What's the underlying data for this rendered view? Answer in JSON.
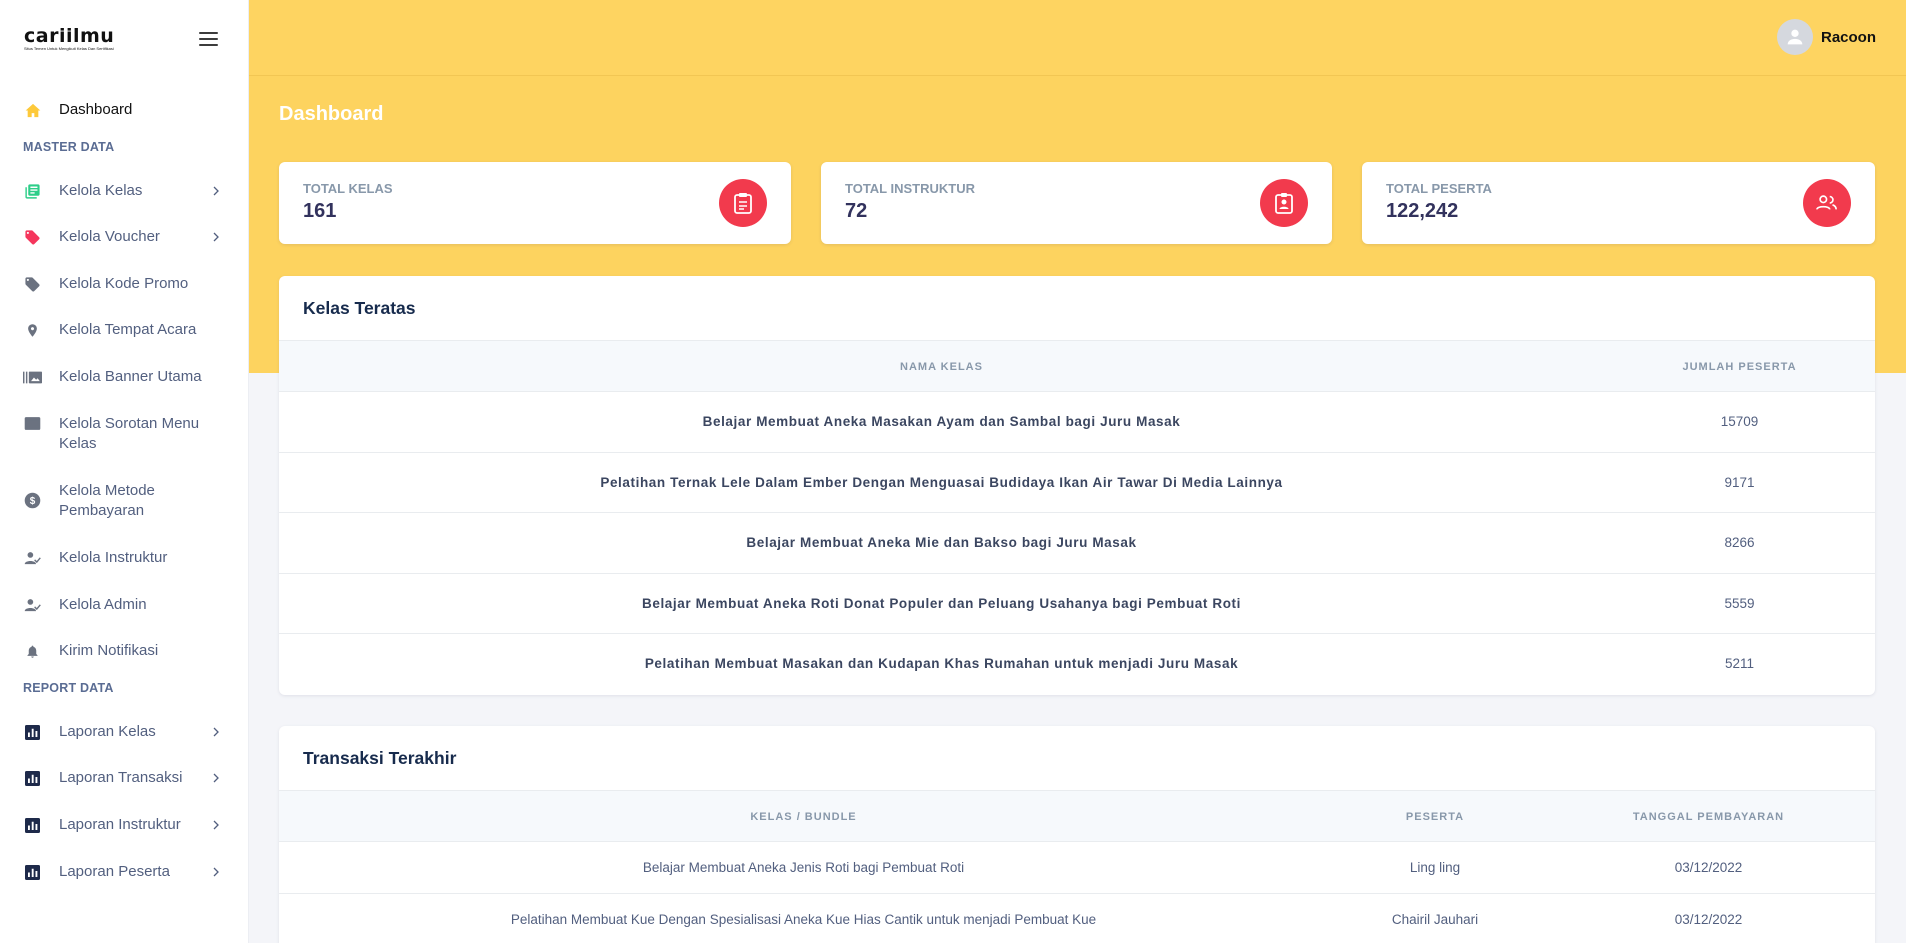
{
  "brand": {
    "name": "cariilmu",
    "tagline": "Situs Temen Untuk Mengikuti Kelas Dan Sertifikasi"
  },
  "sidebar": {
    "dashboard": "Dashboard",
    "master_title": "MASTER DATA",
    "master_items": [
      {
        "label": "Kelola Kelas",
        "icon": "book-icon",
        "has_chevron": true
      },
      {
        "label": "Kelola Voucher",
        "icon": "tag-icon",
        "has_chevron": true
      },
      {
        "label": "Kelola Kode Promo",
        "icon": "label-icon",
        "has_chevron": false
      },
      {
        "label": "Kelola Tempat Acara",
        "icon": "location-pin-icon",
        "has_chevron": false
      },
      {
        "label": "Kelola Banner Utama",
        "icon": "gallery-icon",
        "has_chevron": false
      },
      {
        "label": "Kelola Sorotan Menu Kelas",
        "icon": "web-asset-icon",
        "has_chevron": false
      },
      {
        "label": "Kelola Metode Pembayaran",
        "icon": "dollar-icon",
        "has_chevron": false
      },
      {
        "label": "Kelola Instruktur",
        "icon": "user-check-icon",
        "has_chevron": false
      },
      {
        "label": "Kelola Admin",
        "icon": "user-check-icon",
        "has_chevron": false
      },
      {
        "label": "Kirim Notifikasi",
        "icon": "bell-icon",
        "has_chevron": false
      }
    ],
    "report_title": "REPORT DATA",
    "report_items": [
      {
        "label": "Laporan Kelas",
        "icon": "chart-icon"
      },
      {
        "label": "Laporan Transaksi",
        "icon": "chart-icon"
      },
      {
        "label": "Laporan Instruktur",
        "icon": "chart-icon"
      },
      {
        "label": "Laporan Peserta",
        "icon": "chart-icon"
      }
    ]
  },
  "header": {
    "user_name": "Racoon"
  },
  "page_title": "Dashboard",
  "stats": [
    {
      "label": "TOTAL KELAS",
      "value": "161",
      "icon": "clipboard-icon"
    },
    {
      "label": "TOTAL INSTRUKTUR",
      "value": "72",
      "icon": "id-badge-icon"
    },
    {
      "label": "TOTAL PESERTA",
      "value": "122,242",
      "icon": "users-icon"
    }
  ],
  "top_classes": {
    "title": "Kelas Teratas",
    "columns": [
      "NAMA KELAS",
      "JUMLAH PESERTA"
    ],
    "rows": [
      {
        "name": "Belajar Membuat Aneka Masakan Ayam dan Sambal bagi Juru Masak",
        "count": "15709"
      },
      {
        "name": "Pelatihan Ternak Lele Dalam Ember Dengan Menguasai Budidaya Ikan Air Tawar Di Media Lainnya",
        "count": "9171"
      },
      {
        "name": "Belajar Membuat Aneka Mie dan Bakso bagi Juru Masak",
        "count": "8266"
      },
      {
        "name": "Belajar Membuat Aneka Roti Donat Populer dan Peluang Usahanya bagi Pembuat Roti",
        "count": "5559"
      },
      {
        "name": "Pelatihan Membuat Masakan dan Kudapan Khas Rumahan untuk menjadi Juru Masak",
        "count": "5211"
      }
    ]
  },
  "recent_transactions": {
    "title": "Transaksi Terakhir",
    "columns": [
      "KELAS / BUNDLE",
      "PESERTA",
      "TANGGAL PEMBAYARAN"
    ],
    "rows": [
      {
        "class": "Belajar Membuat Aneka Jenis Roti bagi Pembuat Roti",
        "participant": "Ling ling",
        "date": "03/12/2022"
      },
      {
        "class": "Pelatihan Membuat Kue Dengan Spesialisasi Aneka Kue Hias Cantik untuk menjadi Pembuat Kue",
        "participant": "Chairil Jauhari",
        "date": "03/12/2022"
      }
    ]
  },
  "colors": {
    "accent": "#fdd35f",
    "stat_icon": "#f23a4d",
    "sidebar_bg": "#ffffff"
  }
}
